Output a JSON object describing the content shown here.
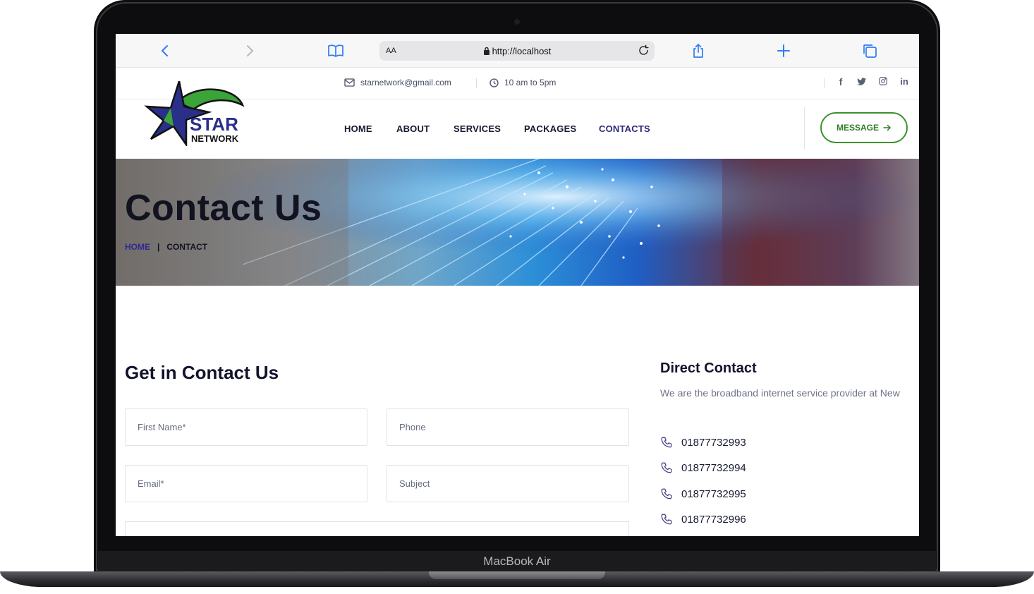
{
  "device": {
    "brand_label": "MacBook Air"
  },
  "browser": {
    "text_size_label": "AA",
    "url": "http://localhost"
  },
  "topbar": {
    "email": "starnetwork@gmail.com",
    "hours": "10 am to 5pm",
    "social": [
      "facebook-icon",
      "twitter-icon",
      "instagram-icon",
      "linkedin-icon"
    ]
  },
  "logo": {
    "line1": "STAR",
    "line2": "NETWORK"
  },
  "nav": {
    "items": [
      {
        "label": "HOME",
        "active": false
      },
      {
        "label": "ABOUT",
        "active": false
      },
      {
        "label": "SERVICES",
        "active": false
      },
      {
        "label": "PACKAGES",
        "active": false
      },
      {
        "label": "CONTACTS",
        "active": true
      }
    ],
    "cta_label": "MESSAGE"
  },
  "hero": {
    "title": "Contact Us",
    "breadcrumb": {
      "home": "HOME",
      "separator": "|",
      "current": "CONTACT"
    }
  },
  "form": {
    "title": "Get in Contact Us",
    "first_name_placeholder": "First Name*",
    "phone_placeholder": "Phone",
    "email_placeholder": "Email*",
    "subject_placeholder": "Subject"
  },
  "direct_contact": {
    "title": "Direct Contact",
    "text": "We are the broadband internet service provider at New",
    "phones": [
      "01877732993",
      "01877732994",
      "01877732995",
      "01877732996"
    ]
  },
  "colors": {
    "brand_green": "#3d8f2e",
    "brand_navy": "#2d2a7a",
    "heading": "#12132b"
  }
}
